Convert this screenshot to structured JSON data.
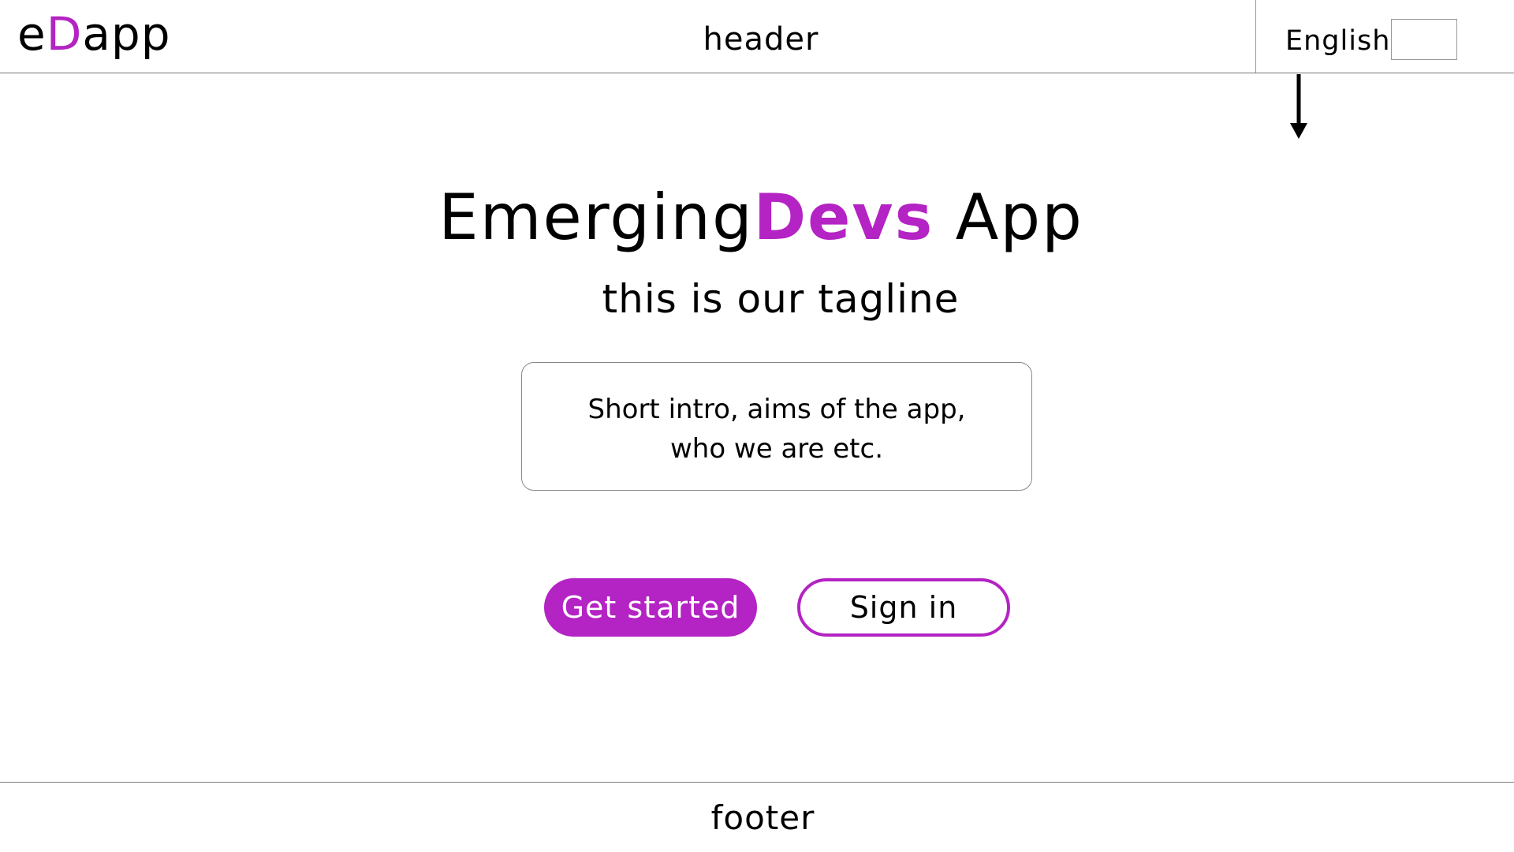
{
  "colors": {
    "accent": "#b423c3",
    "text": "#000000",
    "border": "#888888"
  },
  "header": {
    "logo": {
      "prefix": "e",
      "accent": "D",
      "suffix": "app"
    },
    "label": "header",
    "language": {
      "label": "English",
      "selected_value": "",
      "dropdown_icon": "arrow-down-icon"
    }
  },
  "hero": {
    "title": {
      "part1": "Emerging",
      "accent": "Devs",
      "part2": " App"
    },
    "tagline": "this is our tagline",
    "intro_line1": "Short intro, aims of the app,",
    "intro_line2": "who we are etc."
  },
  "actions": {
    "get_started_label": "Get started",
    "sign_in_label": "Sign in"
  },
  "footer": {
    "label": "footer"
  }
}
